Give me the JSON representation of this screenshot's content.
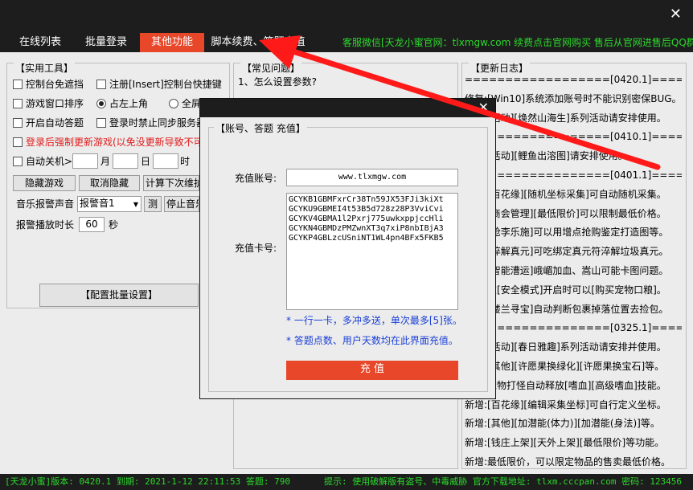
{
  "window": {
    "close_glyph": "✕"
  },
  "tabs": [
    {
      "label": "在线列表"
    },
    {
      "label": "批量登录"
    },
    {
      "label": "其他功能",
      "active": true
    },
    {
      "label": "脚本续费、答题充值"
    }
  ],
  "marquee": "客服微信[天龙小蜜官网：tlxmgw.com 续费点击官网购买 售后从官网进售后QQ群]",
  "tools": {
    "title": "【实用工具】",
    "cb_console_free": "控制台免遮挡",
    "cb_register_hotkey": "注册[Insert]控制台快捷键",
    "cb_window_sort": "游戏窗口排序",
    "rb_top_left": "占左上角",
    "rb_full": "全屏",
    "cb_auto_answer": "开启自动答题",
    "cb_disable_sync": "登录时禁止同步服务器",
    "cb_force_update": "登录后强制更新游戏(以免没更新导致不可",
    "cb_auto_shutdown": "自动关机>",
    "month_label": "月",
    "day_label": "日",
    "hour_label": "时",
    "btn_hide_game": "隐藏游戏",
    "btn_unhide": "取消隐藏",
    "btn_calc_maint": "计算下次维护时间",
    "alarm_sound_label": "音乐报警声音",
    "alarm_sound_value": "报警音1",
    "btn_test": "测",
    "btn_stop_sound": "停止音乐",
    "alarm_duration_label": "报警播放时长",
    "alarm_duration_value": "60",
    "seconds_label": "秒",
    "btn_batch_config": "【配置批量设置】"
  },
  "faq": {
    "title": "【常见问题】",
    "q1": "1、怎么设置参数?"
  },
  "changelog": {
    "title": "【更新日志】",
    "lines": [
      "==================[0420.1]==================",
      "修复:[Win10]系统添加账号时不能识别密保BUG。",
      "新增:[活动][焕然山海生]系列活动请安排使用。",
      "==================[0410.1]==================",
      "新增:[活动][鲤鱼出溶图]请安排使用。",
      "==================[0401.1]==================",
      "新增:[百花缘][随机坐标采集]可自动随机采集。",
      "新增:[商会管理][最低限价]可以限制最低价格。",
      "新增:[抢李乐施]可以用增点抢购鉴定打造图等。",
      "新增:[淬解真元]可吃绑定真元符淬解垃圾真元。",
      "新增:[智能漕运]峨嵋加血、嵩山可能卡图问题。",
      "新增:在[安全模式]开启时可以[购买宠物口粮]。",
      "新增:[楼兰寻宝]自动判断包裹掉落位置去捡包。",
      "==================[0325.1]==================",
      "新增:[活动][春日雅趣]系列活动请安排并使用。",
      "新增:[其他][许愿果换绿化][许愿果换宝石]等。",
      "新增:宠物打怪自动释放[嗜血][高级嗜血]技能。",
      "新增:[百花缘][编辑采集坐标]可自行定义坐标。",
      "新增:[其他][加潜能(体力)][加潜能(身法)]等。",
      "新增:[钱庄上架][天外上架][最低限价]等功能。",
      "新增:最低限价，可以限定物品的售卖最低价格。"
    ]
  },
  "status": {
    "left": "[天龙小蜜]版本: 0420.1  到期: 2021-1-12 22:11:53  答题: 790",
    "right": "提示: 使用破解版有盗号、中毒威胁 官方下载地址: tlxm.cccpan.com 密码: 123456"
  },
  "modal": {
    "close_glyph": "✕",
    "group_title": "【账号、答题 充值】",
    "account_label": "充值账号:",
    "account_value": "www.tlxmgw.com",
    "card_label": "充值卡号:",
    "card_lines": [
      "GCYKB1GBMFxrCr38Tn59JX53FJi3kiXt",
      "GCYKU9GBMEI4t53B5d728z28P3VviCvi",
      "GCYKV4GBMA1l2Pxrj775uwkxppjccHli",
      "GCYKN4GBMDzPMZwnXT3q7xiP8nbIBjA3",
      "GCYKP4GBLzcUSniNT1WL4pn4BFx5FKB5"
    ],
    "tip1": "* 一行一卡，多冲多送，单次最多[5]张。",
    "tip2": "* 答题点数、用户天数均在此界面充值。",
    "charge_btn": "充  值"
  },
  "colors": {
    "accent": "#e8472a",
    "status_green": "#2bd92b",
    "tip_blue": "#1a3fd6",
    "alert_red": "#e01b1b"
  }
}
